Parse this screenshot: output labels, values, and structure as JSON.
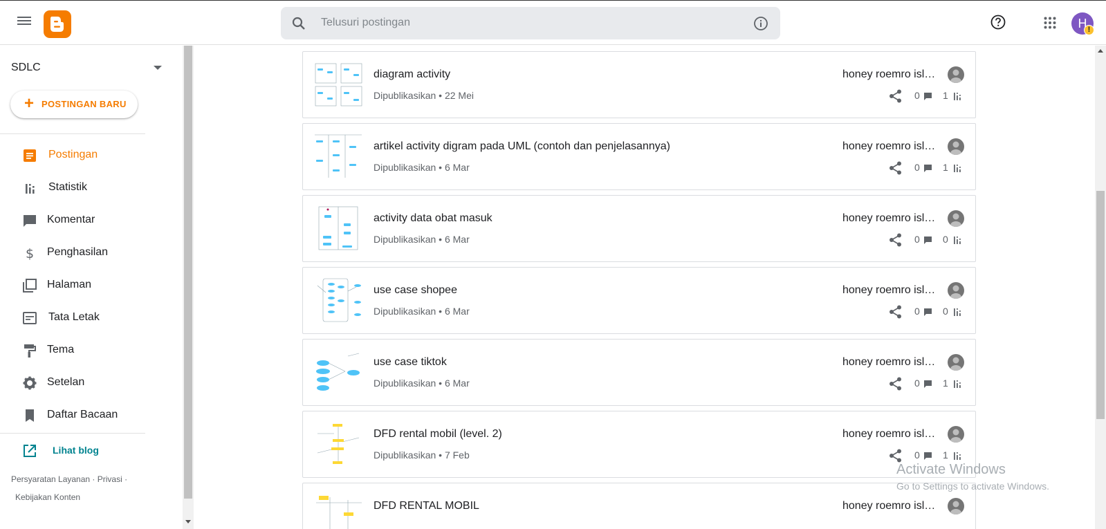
{
  "header": {
    "search_placeholder": "Telusuri postingan",
    "avatar_initial": "H",
    "avatar_warning": "!"
  },
  "sidebar": {
    "blog_name": "SDLC",
    "new_post_label": "POSTINGAN BARU",
    "items": [
      {
        "label": "Postingan",
        "icon": "posts-icon",
        "active": true
      },
      {
        "label": "Statistik",
        "icon": "stats-icon"
      },
      {
        "label": "Komentar",
        "icon": "comment-icon"
      },
      {
        "label": "Penghasilan",
        "icon": "dollar-icon"
      },
      {
        "label": "Halaman",
        "icon": "pages-icon"
      },
      {
        "label": "Tata Letak",
        "icon": "layout-icon"
      },
      {
        "label": "Tema",
        "icon": "paint-roller-icon"
      },
      {
        "label": "Setelan",
        "icon": "gear-icon"
      },
      {
        "label": "Daftar Bacaan",
        "icon": "bookmark-icon"
      }
    ],
    "view_blog": "Lihat blog",
    "footer": {
      "terms": "Persyaratan Layanan",
      "privacy": "Privasi",
      "content_policy": "Kebijakan Konten",
      "dot": "·"
    }
  },
  "posts": [
    {
      "title": "diagram activity",
      "meta": "Dipublikasikan • 22 Mei",
      "author": "honey roemro isla...",
      "comments": "0",
      "views": "1"
    },
    {
      "title": "artikel activity digram pada UML (contoh dan penjelasannya)",
      "meta": "Dipublikasikan • 6 Mar",
      "author": "honey roemro isla...",
      "comments": "0",
      "views": "1"
    },
    {
      "title": "activity data obat masuk",
      "meta": "Dipublikasikan • 6 Mar",
      "author": "honey roemro isla...",
      "comments": "0",
      "views": "0"
    },
    {
      "title": "use case shopee",
      "meta": "Dipublikasikan • 6 Mar",
      "author": "honey roemro isla...",
      "comments": "0",
      "views": "0"
    },
    {
      "title": "use case tiktok",
      "meta": "Dipublikasikan • 6 Mar",
      "author": "honey roemro isla...",
      "comments": "0",
      "views": "1"
    },
    {
      "title": "DFD rental mobil (level. 2)",
      "meta": "Dipublikasikan • 7 Feb",
      "author": "honey roemro isla...",
      "comments": "0",
      "views": "1"
    },
    {
      "title": "DFD RENTAL MOBIL",
      "meta": "",
      "author": "honey roemro isla...",
      "comments": "",
      "views": ""
    }
  ],
  "watermark": {
    "line1": "Activate Windows",
    "line2": "Go to Settings to activate Windows."
  },
  "colors": {
    "accent": "#f57c00",
    "link": "#00838f"
  }
}
